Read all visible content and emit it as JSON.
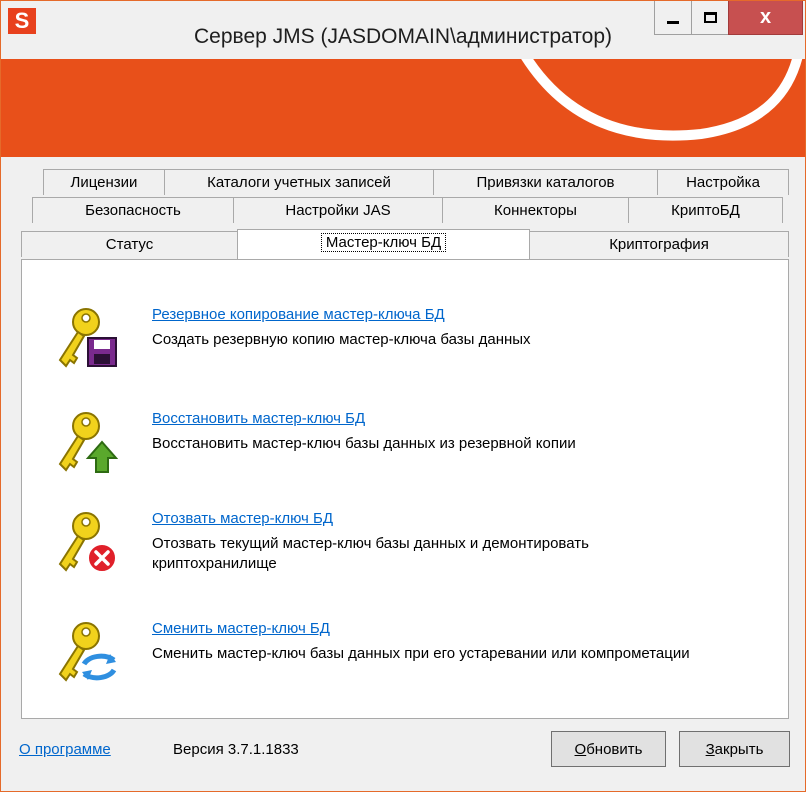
{
  "window": {
    "app_icon": "S",
    "title": "Сервер JMS (JASDOMAIN\\администратор)",
    "close_glyph": "x"
  },
  "tabs": {
    "row1": [
      "Лицензии",
      "Каталоги учетных записей",
      "Привязки каталогов",
      "Настройка"
    ],
    "row2": [
      "Безопасность",
      "Настройки JAS",
      "Коннекторы",
      "КриптоБД"
    ],
    "row3": [
      "Статус",
      "Мастер-ключ БД",
      "Криптография"
    ],
    "active": "Мастер-ключ БД"
  },
  "items": [
    {
      "icon": "key-save-icon",
      "link": "Резервное копирование мастер-ключа БД",
      "desc": "Создать резервную копию мастер-ключа базы данных"
    },
    {
      "icon": "key-restore-icon",
      "link": "Восстановить мастер-ключ БД",
      "desc": "Восстановить мастер-ключ базы данных из резервной копии"
    },
    {
      "icon": "key-revoke-icon",
      "link": "Отозвать мастер-ключ БД",
      "desc": "Отозвать текущий мастер-ключ базы данных и демонтировать криптохранилище"
    },
    {
      "icon": "key-change-icon",
      "link": "Сменить мастер-ключ БД",
      "desc": "Сменить мастер-ключ базы данных при его устаревании или компрометации"
    }
  ],
  "footer": {
    "about_link": "О программе",
    "version": "Версия 3.7.1.1833",
    "refresh_first": "О",
    "refresh_rest": "бновить",
    "close_first": "З",
    "close_rest": "акрыть"
  },
  "colors": {
    "brand": "#e8501a",
    "link": "#0066cc",
    "key": "#f1d21c"
  }
}
